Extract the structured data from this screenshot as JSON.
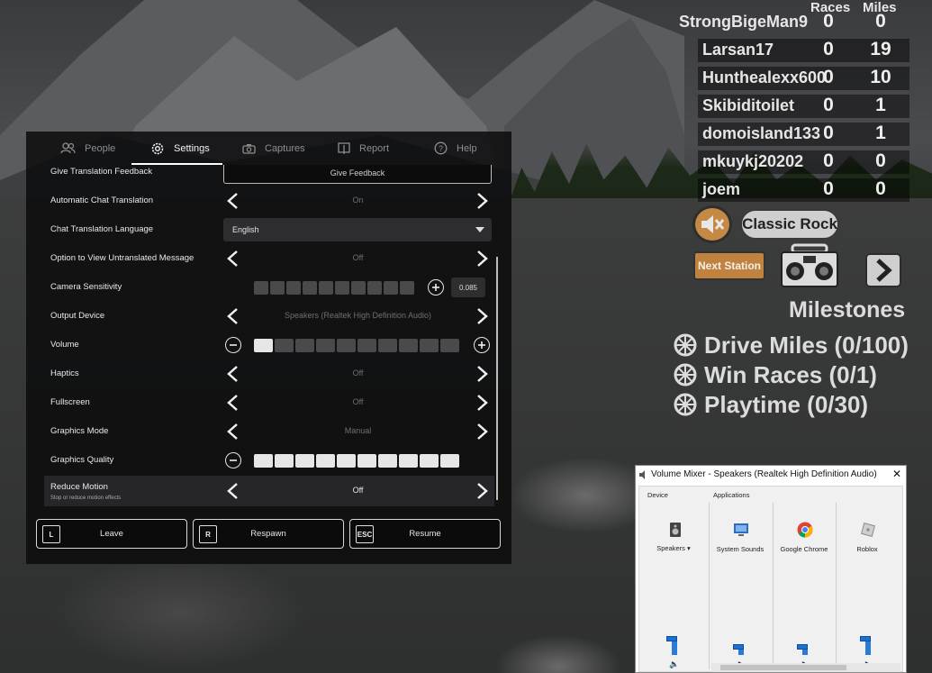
{
  "leaderboard": {
    "col_races": "Races",
    "col_miles": "Miles",
    "players": [
      {
        "name": "StrongBigeMan9",
        "races": "0",
        "miles": "0"
      },
      {
        "name": "Larsan17",
        "races": "0",
        "miles": "19"
      },
      {
        "name": "Hunthealexx600",
        "races": "0",
        "miles": "10"
      },
      {
        "name": "Skibiditoilet",
        "races": "0",
        "miles": "1"
      },
      {
        "name": "domoisland133",
        "races": "0",
        "miles": "1"
      },
      {
        "name": "mkuykj20202",
        "races": "0",
        "miles": "0"
      },
      {
        "name": "joem",
        "races": "0",
        "miles": "0"
      }
    ]
  },
  "radio": {
    "mute_icon": "speaker-muted-icon",
    "station": "Classic Rock",
    "next_station": "Next Station",
    "boombox_icon": "boombox-icon",
    "next_icon": "chevron-right-icon"
  },
  "milestones": {
    "title": "Milestones",
    "items": [
      "Drive Miles (0/100)",
      "Win Races (0/1)",
      "Playtime (0/30)"
    ]
  },
  "menu": {
    "tabs": [
      {
        "label": "People",
        "icon": "people-icon"
      },
      {
        "label": "Settings",
        "icon": "gear-icon"
      },
      {
        "label": "Captures",
        "icon": "camera-icon"
      },
      {
        "label": "Report",
        "icon": "flag-icon"
      },
      {
        "label": "Help",
        "icon": "question-icon"
      }
    ],
    "active_tab": "Settings",
    "settings": {
      "feedback_label": "Give Translation Feedback",
      "feedback_button": "Give Feedback",
      "auto_translate_label": "Automatic Chat Translation",
      "auto_translate_value": "On",
      "translate_lang_label": "Chat Translation Language",
      "translate_lang_value": "English",
      "untranslated_label": "Option to View Untranslated Message",
      "untranslated_value": "Off",
      "camera_label": "Camera Sensitivity",
      "camera_value": "0.085",
      "camera_level": 0,
      "output_label": "Output Device",
      "output_value": "Speakers (Realtek High Definition Audio)",
      "volume_label": "Volume",
      "volume_level": 1,
      "haptics_label": "Haptics",
      "haptics_value": "Off",
      "fullscreen_label": "Fullscreen",
      "fullscreen_value": "Off",
      "graphics_mode_label": "Graphics Mode",
      "graphics_mode_value": "Manual",
      "graphics_quality_label": "Graphics Quality",
      "graphics_quality_level": 10,
      "reduce_motion_label": "Reduce Motion",
      "reduce_motion_sub": "Stop or reduce motion effects",
      "reduce_motion_value": "Off"
    },
    "footer": {
      "leave_key": "L",
      "leave_label": "Leave",
      "respawn_key": "R",
      "respawn_label": "Respawn",
      "resume_key": "ESC",
      "resume_label": "Resume"
    }
  },
  "mixer": {
    "title": "Volume Mixer - Speakers (Realtek High Definition Audio)",
    "close": "✕",
    "device_label": "Device",
    "apps_label": "Applications",
    "columns": [
      {
        "name": "Speakers",
        "icon": "speaker-device-icon",
        "level": 0.2
      },
      {
        "name": "System Sounds",
        "icon": "system-sounds-icon",
        "level": 0.1
      },
      {
        "name": "Google Chrome",
        "icon": "chrome-icon",
        "level": 0.1
      },
      {
        "name": "Roblox",
        "icon": "roblox-icon",
        "level": 0.2
      }
    ]
  },
  "colors": {
    "accent_orange": "#c48a45",
    "panel_bg": "#0c0c0d",
    "mixer_blue": "#2a7bd8"
  }
}
